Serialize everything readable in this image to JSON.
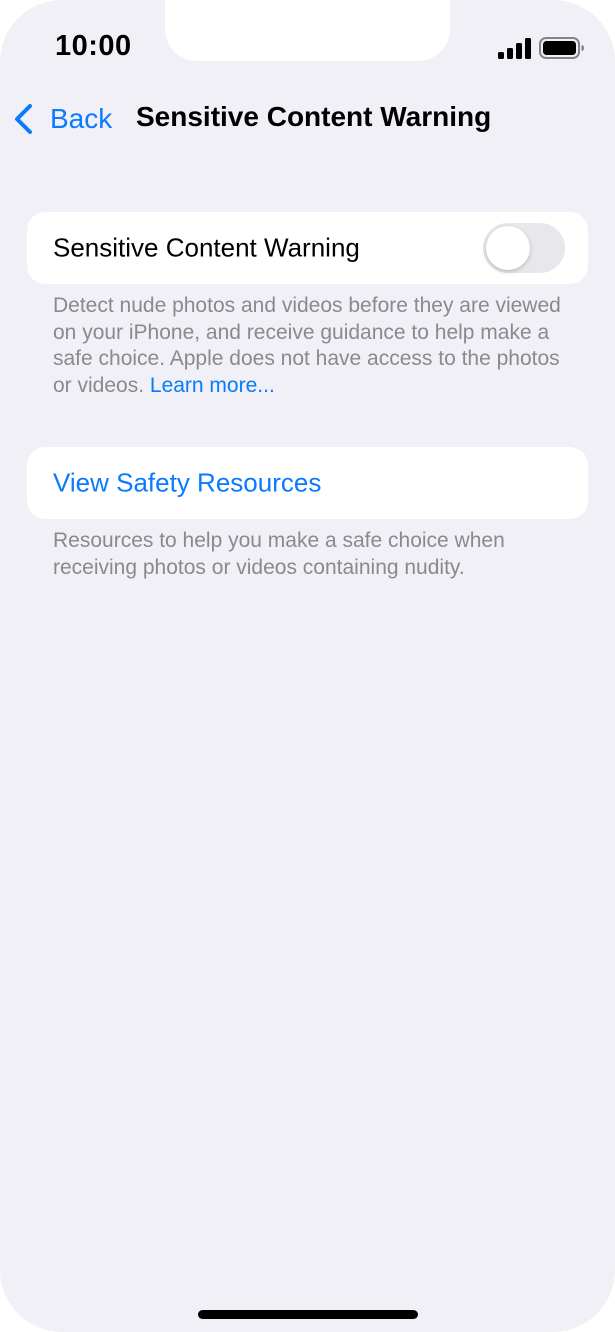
{
  "status_bar": {
    "time": "10:00",
    "signal_icon": "cellular-signal-icon",
    "battery_icon": "battery-icon"
  },
  "nav": {
    "back_icon": "chevron-left-icon",
    "back_label": "Back",
    "title": "Sensitive Content Warning"
  },
  "toggle_section": {
    "label": "Sensitive Content Warning",
    "toggle_on": false,
    "footer_text": "Detect nude photos and videos before they are viewed on your iPhone, and receive guidance to help make a safe choice. Apple does not have access to the photos or videos.",
    "footer_link": "Learn more..."
  },
  "resources_section": {
    "label": "View Safety Resources",
    "footer_text": "Resources to help you make a safe choice when receiving photos or videos containing nudity."
  },
  "colors": {
    "accent": "#0a7aff",
    "background": "#f0f0f6",
    "card": "#ffffff",
    "secondary_text": "#8a8a8e",
    "toggle_off": "#e7e7ec"
  }
}
